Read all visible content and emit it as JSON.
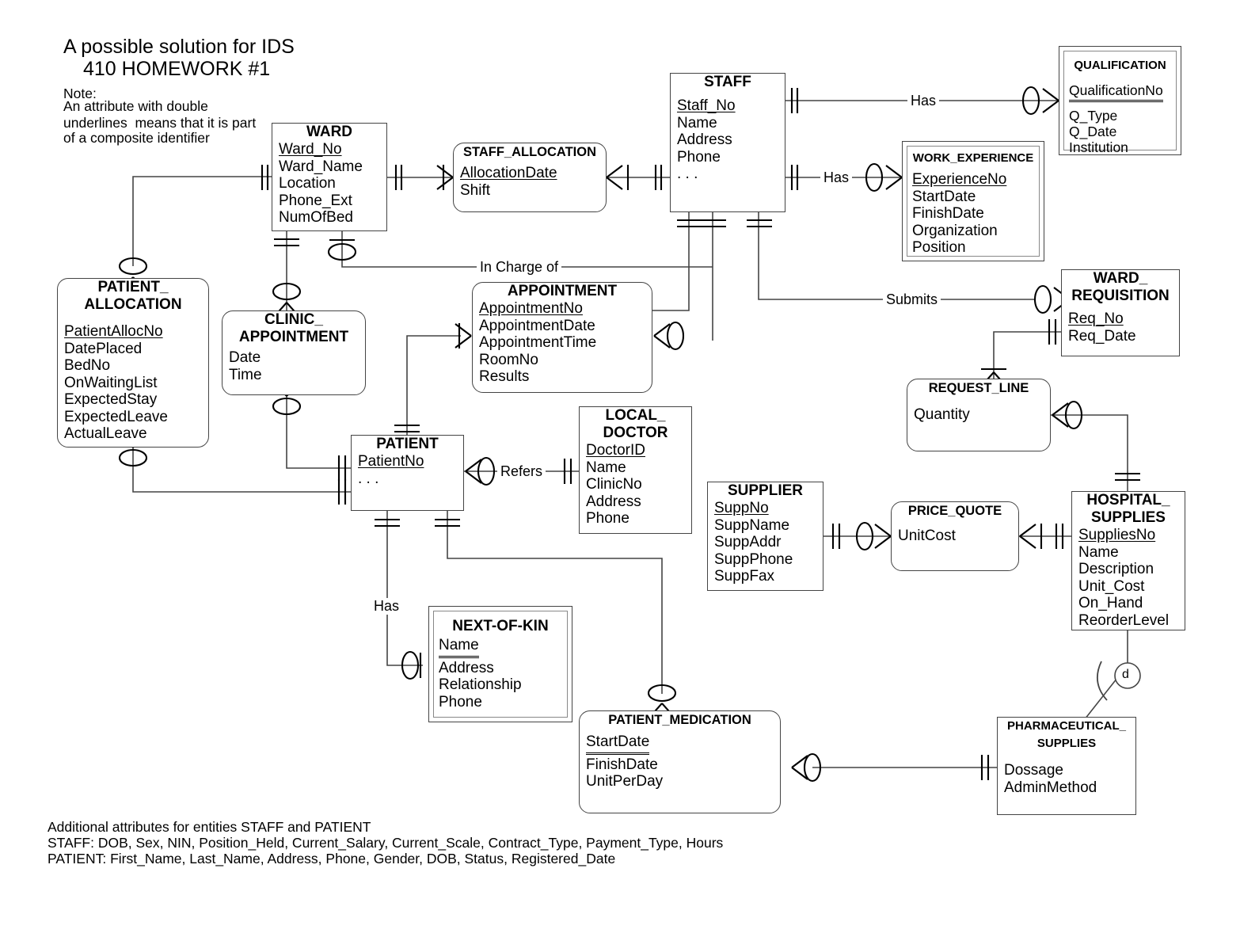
{
  "title": {
    "line1": "A possible solution for IDS",
    "line2": "410 HOMEWORK #1"
  },
  "note": {
    "heading": "Note:",
    "line1": "An attribute with double",
    "line2": "underlines  means that it is part",
    "line3": "of a composite identifier"
  },
  "footnotes": {
    "line1": "Additional attributes for entities STAFF and PATIENT",
    "line2": "STAFF: DOB, Sex, NIN, Position_Held, Current_Salary, Current_Scale, Contract_Type, Payment_Type, Hours",
    "line3": "PATIENT: First_Name, Last_Name, Address, Phone, Gender, DOB, Status, Registered_Date"
  },
  "entities": {
    "ward": {
      "name": "WARD",
      "attrs": [
        "Ward_No",
        "Ward_Name",
        "Location",
        "Phone_Ext",
        "NumOfBed"
      ]
    },
    "staff_allocation": {
      "name": "STAFF_ALLOCATION",
      "attrs": [
        "AllocationDate",
        "Shift"
      ]
    },
    "staff": {
      "name": "STAFF",
      "attrs": [
        "Staff_No",
        "Name",
        "Address",
        "Phone",
        ". . ."
      ]
    },
    "qualification": {
      "name": "QUALIFICATION",
      "attrs": [
        "QualificationNo",
        "Q_Type",
        "Q_Date",
        "Institution"
      ]
    },
    "work_experience": {
      "name": "WORK_EXPERIENCE",
      "attrs": [
        "ExperienceNo",
        "StartDate",
        "FinishDate",
        "Organization",
        "Position"
      ]
    },
    "patient_allocation": {
      "name": "PATIENT_\nALLOCATION",
      "attrs": [
        "PatientAllocNo",
        "DatePlaced",
        "BedNo",
        "OnWaitingList",
        "ExpectedStay",
        "ExpectedLeave",
        "ActualLeave"
      ]
    },
    "clinic_appointment": {
      "name": "CLINIC_\nAPPOINTMENT",
      "attrs": [
        "Date",
        "Time"
      ]
    },
    "appointment": {
      "name": "APPOINTMENT",
      "attrs": [
        "AppointmentNo",
        "AppointmentDate",
        "AppointmentTime",
        "RoomNo",
        "Results"
      ]
    },
    "ward_requisition": {
      "name": "WARD_\nREQUISITION",
      "attrs": [
        "Req_No",
        "Req_Date"
      ]
    },
    "request_line": {
      "name": "REQUEST_LINE",
      "attrs": [
        "Quantity"
      ]
    },
    "patient": {
      "name": "PATIENT",
      "attrs": [
        "PatientNo",
        ". . ."
      ]
    },
    "local_doctor": {
      "name": "LOCAL_\nDOCTOR",
      "attrs": [
        "DoctorID",
        "Name",
        "ClinicNo",
        "Address",
        "Phone"
      ]
    },
    "supplier": {
      "name": "SUPPLIER",
      "attrs": [
        "SuppNo",
        "SuppName",
        "SuppAddr",
        "SuppPhone",
        "SuppFax"
      ]
    },
    "price_quote": {
      "name": "PRICE_QUOTE",
      "attrs": [
        "UnitCost"
      ]
    },
    "hospital_supplies": {
      "name": "HOSPITAL_\nSUPPLIES",
      "attrs": [
        "SuppliesNo",
        "Name",
        "Description",
        "Unit_Cost",
        "On_Hand",
        "ReorderLevel"
      ]
    },
    "next_of_kin": {
      "name": "NEXT-OF-KIN",
      "attrs": [
        "Name",
        "Address",
        "Relationship",
        "Phone"
      ]
    },
    "patient_medication": {
      "name": "PATIENT_MEDICATION",
      "attrs": [
        "StartDate ",
        "FinishDate",
        "UnitPerDay"
      ]
    },
    "pharmaceutical_supplies": {
      "name": "PHARMACEUTICAL_\nSUPPLIES",
      "attrs": [
        "Dossage",
        "AdminMethod"
      ]
    }
  },
  "relationships": {
    "has_qualification": "Has",
    "has_work_experience": "Has",
    "in_charge_of": "In Charge of",
    "submits": "Submits",
    "refers": "Refers",
    "has_next_of_kin": "Has"
  },
  "symbols": {
    "disjoint": "d"
  },
  "colors": {
    "line": "#444444",
    "text": "#000000",
    "background": "#ffffff"
  }
}
